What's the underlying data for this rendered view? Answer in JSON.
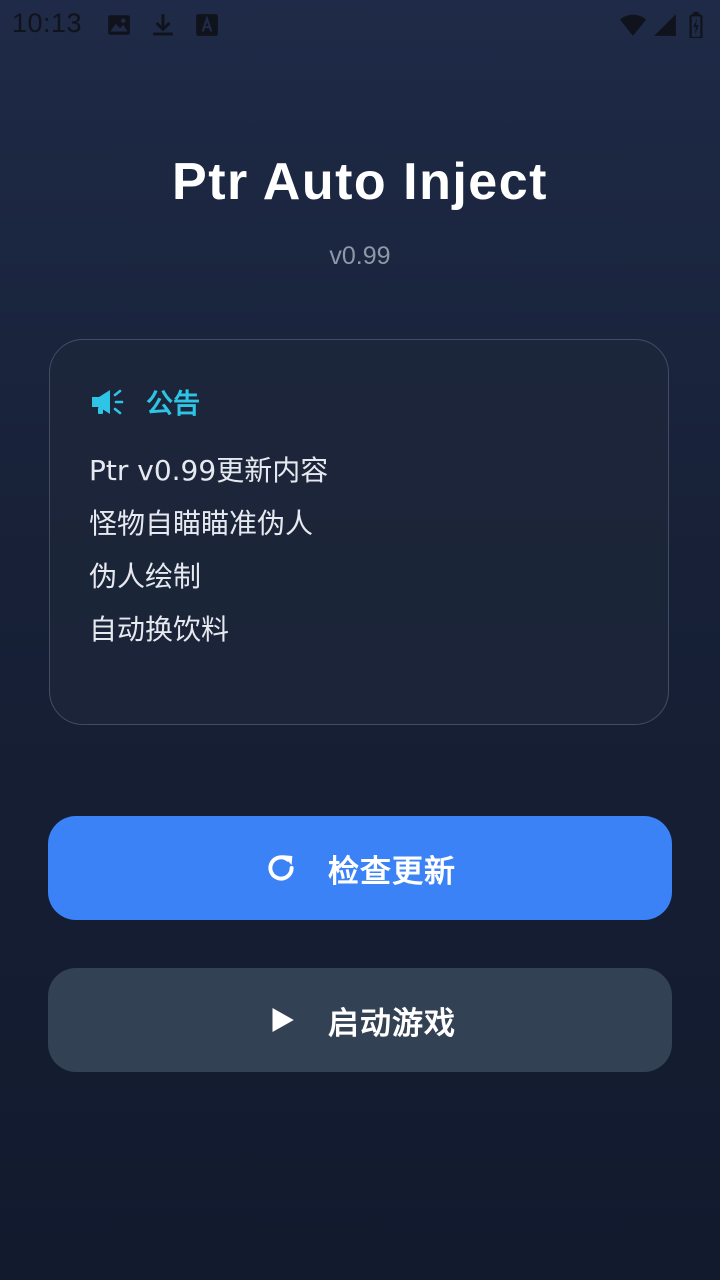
{
  "status_bar": {
    "time": "10:13",
    "left_icons": [
      "image-icon",
      "download-icon",
      "app-notification-icon"
    ],
    "right_icons": [
      "wifi-icon",
      "cellular-signal-icon",
      "battery-charging-icon"
    ]
  },
  "app": {
    "title": "Ptr Auto Inject",
    "version": "v0.99"
  },
  "notice": {
    "icon": "megaphone-icon",
    "title": "公告",
    "lines": [
      "Ptr v0.99更新内容",
      "怪物自瞄瞄准伪人",
      "伪人绘制",
      "自动换饮料"
    ]
  },
  "buttons": {
    "check_update": {
      "icon": "refresh-icon",
      "label": "检查更新"
    },
    "launch_game": {
      "icon": "play-icon",
      "label": "启动游戏"
    }
  },
  "colors": {
    "background_top": "#1e2a47",
    "background_bottom": "#121a2e",
    "accent_cyan": "#2ec4e6",
    "primary_button": "#3b82f6",
    "secondary_button": "#334155",
    "version_text": "#8e97a8"
  }
}
